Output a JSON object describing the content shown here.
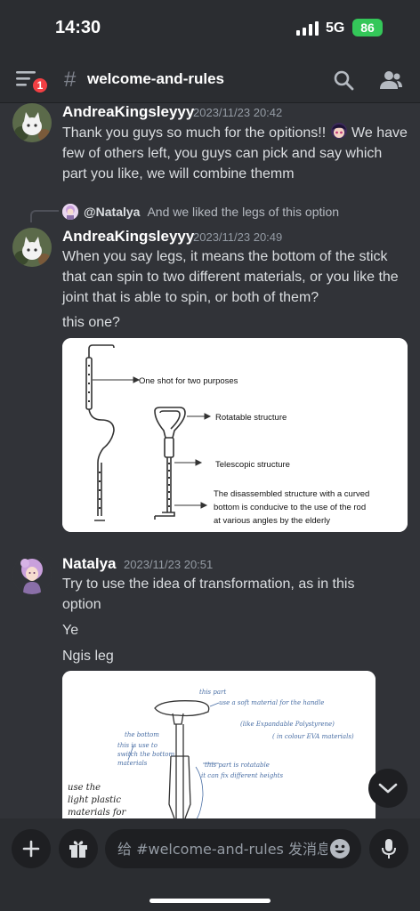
{
  "status_bar": {
    "time": "14:30",
    "network": "5G",
    "battery": "86"
  },
  "header": {
    "channel_name": "welcome-and-rules",
    "unread_badge": "1"
  },
  "messages": [
    {
      "author": "AndreaKingsleyyy",
      "timestamp": "2023/11/23 20:42",
      "text_before_emoji": "Thank you guys so much for the opitions!! ",
      "text_after_emoji": " We have few of others left, you guys can pick and say which part you like, we will combine themm"
    },
    {
      "reply": {
        "mention": "@Natalya",
        "text": "And we liked the legs of this option"
      },
      "author": "AndreaKingsleyyy",
      "timestamp": "2023/11/23 20:49",
      "text": "When you say legs, it means the bottom of the stick that can spin to two different materials, or you like the joint that is able to spin, or both of them?",
      "followup": "this one?",
      "image_labels": [
        "One shot for two purposes",
        "Rotatable structure",
        "Telescopic structure",
        "The disassembled structure with a curved",
        "bottom is conducive to the use of the rod",
        "at various angles by the elderly"
      ]
    },
    {
      "author": "Natalya",
      "timestamp": "2023/11/23 20:51",
      "text": "Try to use the idea of transformation, as in this option",
      "line2": "Ye",
      "line3": "Ngis leg",
      "sketch_notes": [
        "this part",
        "use a soft material for the handle",
        "(like Expandable Polystyrene)",
        "( in colour EVA materials)",
        "the bottom",
        "this is use to",
        "switch the bottom",
        "materials",
        "this part is rotatable",
        "it can fix different heights",
        "use the",
        "light plastic",
        "materials for"
      ]
    }
  ],
  "composer": {
    "placeholder": "给 #welcome-and-rules 发消息"
  },
  "colors": {
    "background": "#313338",
    "bar": "#2b2d31",
    "badge": "#f23f43",
    "battery": "#34c759"
  }
}
